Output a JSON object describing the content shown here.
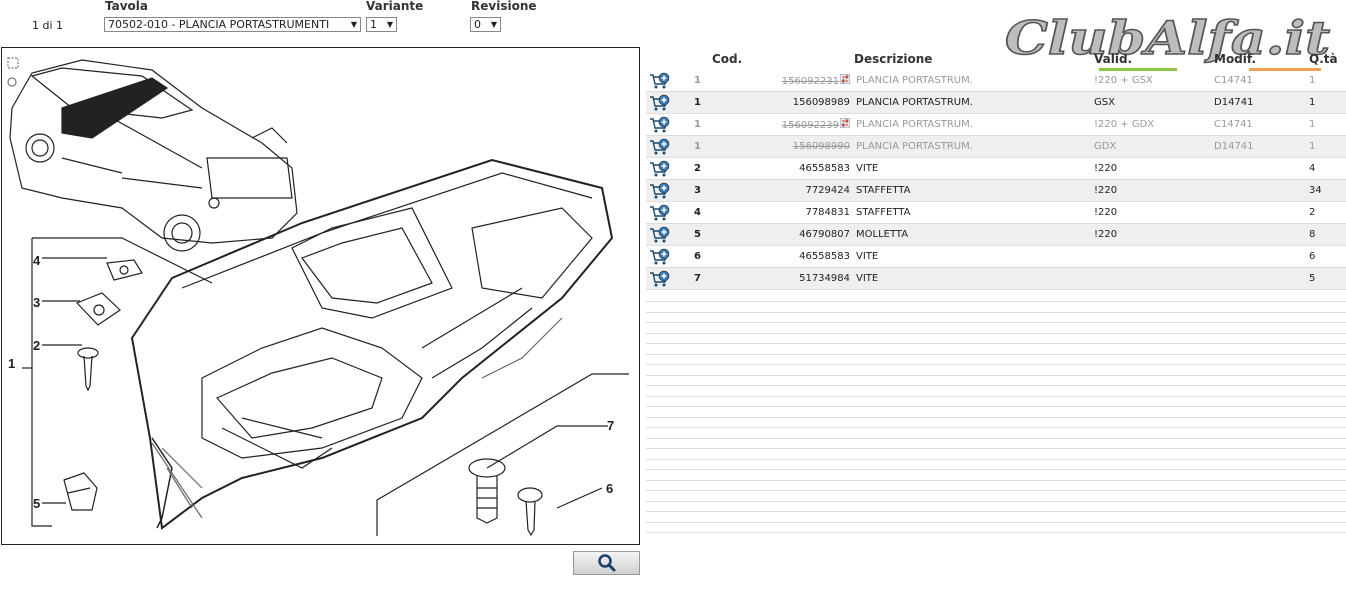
{
  "header": {
    "counter": "1 di 1",
    "tavola_label": "Tavola",
    "tavola_value": "70502-010 - PLANCIA PORTASTRUMENTI",
    "variante_label": "Variante",
    "variante_value": "1",
    "revisione_label": "Revisione",
    "revisione_value": "0"
  },
  "logo": {
    "text": "ClubAlfa.it"
  },
  "diagram": {
    "callouts": [
      "1",
      "2",
      "3",
      "4",
      "5",
      "6",
      "7"
    ]
  },
  "table": {
    "headers": {
      "cod": "Cod.",
      "descrizione": "Descrizione",
      "valid": "Valid.",
      "modif": "Modif.",
      "qta": "Q.tà"
    },
    "rows": [
      {
        "pos": "1",
        "code": "156092231",
        "desc": "PLANCIA PORTASTRUM.",
        "valid": "!220 + GSX",
        "modif": "C14741",
        "qty": "1",
        "status": "superseded"
      },
      {
        "pos": "1",
        "code": "156098989",
        "desc": "PLANCIA PORTASTRUM.",
        "valid": "GSX",
        "modif": "D14741",
        "qty": "1",
        "status": "active"
      },
      {
        "pos": "1",
        "code": "156092239",
        "desc": "PLANCIA PORTASTRUM.",
        "valid": "!220 + GDX",
        "modif": "C14741",
        "qty": "1",
        "status": "superseded"
      },
      {
        "pos": "1",
        "code": "156098990",
        "desc": "PLANCIA PORTASTRUM.",
        "valid": "GDX",
        "modif": "D14741",
        "qty": "1",
        "status": "superseded"
      },
      {
        "pos": "2",
        "code": "46558583",
        "desc": "VITE",
        "valid": "!220",
        "modif": "",
        "qty": "4",
        "status": "active"
      },
      {
        "pos": "3",
        "code": "7729424",
        "desc": "STAFFETTA",
        "valid": "!220",
        "modif": "",
        "qty": "34",
        "status": "active"
      },
      {
        "pos": "4",
        "code": "7784831",
        "desc": "STAFFETTA",
        "valid": "!220",
        "modif": "",
        "qty": "2",
        "status": "active"
      },
      {
        "pos": "5",
        "code": "46790807",
        "desc": "MOLLETTA",
        "valid": "!220",
        "modif": "",
        "qty": "8",
        "status": "active"
      },
      {
        "pos": "6",
        "code": "46558583",
        "desc": "VITE",
        "valid": "",
        "modif": "",
        "qty": "6",
        "status": "active"
      },
      {
        "pos": "7",
        "code": "51734984",
        "desc": "VITE",
        "valid": "",
        "modif": "",
        "qty": "5",
        "status": "active"
      }
    ]
  },
  "icons": {
    "cart": "add-to-cart-icon",
    "zoom": "search-icon",
    "swap": "swap-icon",
    "select_tool": "select-area-icon",
    "zoom_tool": "zoom-in-icon"
  },
  "colors": {
    "accent_green": "#8cc63f",
    "accent_orange": "#f0a050",
    "row_shade": "#efefef",
    "superseded_text": "#999999"
  }
}
